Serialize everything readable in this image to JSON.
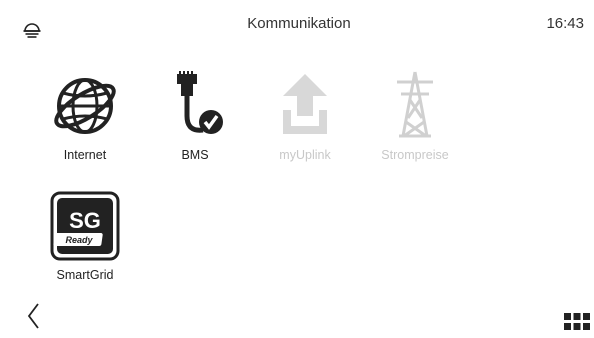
{
  "header": {
    "title": "Kommunikation",
    "time": "16:43"
  },
  "tiles": [
    {
      "label": "Internet",
      "enabled": true
    },
    {
      "label": "BMS",
      "enabled": true
    },
    {
      "label": "myUplink",
      "enabled": false
    },
    {
      "label": "Strompreise",
      "enabled": false
    },
    {
      "label": "SmartGrid",
      "enabled": true
    }
  ],
  "smartgrid_badge": {
    "top": "SG",
    "bottom": "Ready"
  },
  "icons": {
    "status": "temperature-dome-icon",
    "back": "chevron-left-icon",
    "menu": "grid-menu-icon"
  }
}
